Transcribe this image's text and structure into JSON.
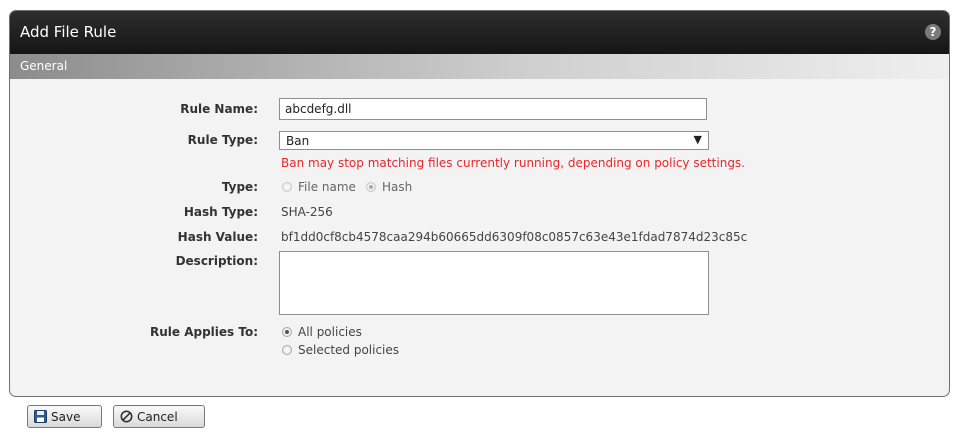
{
  "dialog": {
    "title": "Add File Rule",
    "help_label": "?",
    "section": "General"
  },
  "form": {
    "rule_name": {
      "label": "Rule Name:",
      "value": "abcdefg.dll"
    },
    "rule_type": {
      "label": "Rule Type:",
      "selected": "Ban",
      "warning": "Ban may stop matching files currently running, depending on policy settings."
    },
    "type": {
      "label": "Type:",
      "options": [
        "File name",
        "Hash"
      ],
      "selected": "Hash",
      "disabled": true
    },
    "hash_type": {
      "label": "Hash Type:",
      "value": "SHA-256"
    },
    "hash_value": {
      "label": "Hash Value:",
      "value": "bf1dd0cf8cb4578caa294b60665dd6309f08c0857c63e43e1fdad7874d23c85c"
    },
    "description": {
      "label": "Description:",
      "value": ""
    },
    "applies_to": {
      "label": "Rule Applies To:",
      "options": [
        "All policies",
        "Selected policies"
      ],
      "selected": "All policies"
    }
  },
  "buttons": {
    "save_label": "Save",
    "cancel_label": "Cancel"
  },
  "icons": {
    "help": "help-icon",
    "save": "floppy-disk-icon",
    "cancel": "cancel-circle-icon",
    "dropdown": "dropdown-arrow-icon"
  },
  "colors": {
    "title_bar": "#1f1f1f",
    "warning_text": "#e8272c",
    "dialog_background": "#f3f3f3"
  }
}
